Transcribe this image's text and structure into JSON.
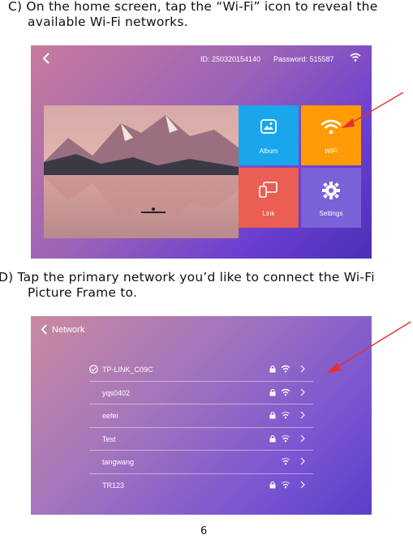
{
  "steps": {
    "c_line1": "C) On the home screen, tap the “Wi-Fi” icon to reveal the",
    "c_line2": "available Wi-Fi networks.",
    "d_line1": "D) Tap the primary network you’d like to connect the Wi-Fi",
    "d_line2": "Picture Frame to."
  },
  "home_screen": {
    "id_text": "ID: 250320154140",
    "password_text": "Password: 515587",
    "tiles": {
      "album": "Album",
      "wifi": "WiFi",
      "link": "Link",
      "settings": "Settings"
    },
    "colors": {
      "album": "#1aa6ea",
      "wifi": "#ff9b06",
      "link": "#ea5e53",
      "settings": "#7a62d8"
    }
  },
  "network_screen": {
    "title": "Network",
    "networks": [
      {
        "ssid": "TP-LINK_C09C",
        "connected": true,
        "locked": true
      },
      {
        "ssid": "yqs0402",
        "connected": false,
        "locked": true
      },
      {
        "ssid": "eefei",
        "connected": false,
        "locked": true
      },
      {
        "ssid": "Test",
        "connected": false,
        "locked": true
      },
      {
        "ssid": "tangwang",
        "connected": false,
        "locked": false
      },
      {
        "ssid": "TR123",
        "connected": false,
        "locked": true
      }
    ]
  },
  "page_number": "6"
}
